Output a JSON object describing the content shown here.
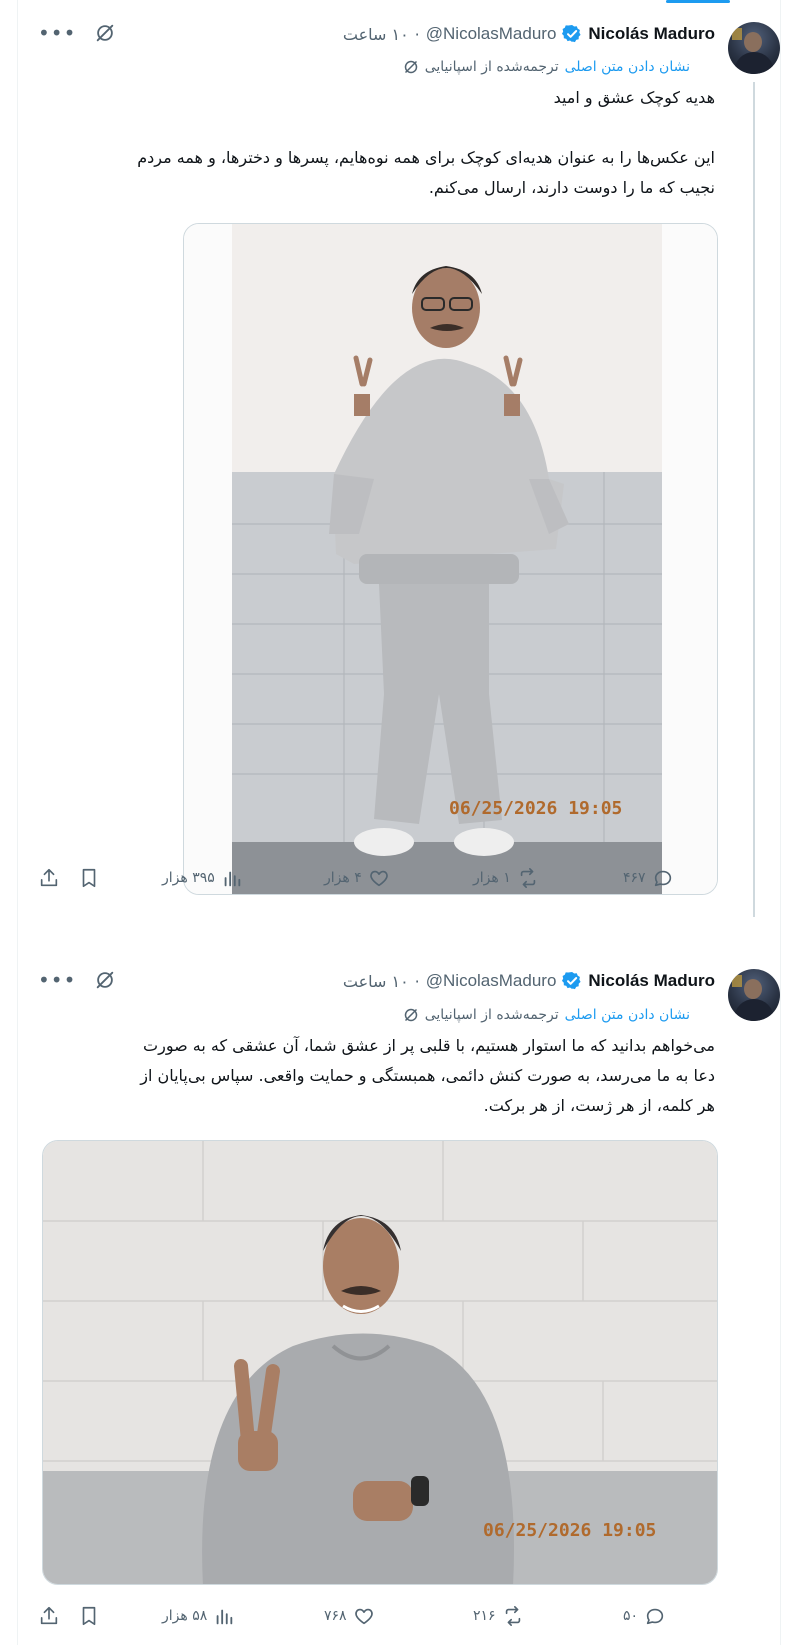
{
  "colors": {
    "accent": "#1d9bf0",
    "text_primary": "#0f1419",
    "text_secondary": "#536471",
    "border": "#cfd9de"
  },
  "tweets": [
    {
      "author": {
        "name": "Nicolás Maduro",
        "handle": "@NicolasMaduro",
        "time": "۱۰ ساعت",
        "separator": "·",
        "verified_icon": "verified-badge-icon"
      },
      "translation": {
        "label": "ترجمه‌شده از اسپانیایی",
        "link": "نشان دادن متن اصلی"
      },
      "text_lines": [
        "هدیه کوچک عشق و امید",
        "",
        "این عکس‌ها را به عنوان هدیه‌ای کوچک برای همه نوه‌هایم، پسرها و دخترها، و همه مردم",
        "نجیب که ما را دوست دارند، ارسال می‌کنم."
      ],
      "media": {
        "description_icon": "photo-man-full-body-peace-sign",
        "timestamp_overlay": "06/25/2026 19:05"
      },
      "stats": {
        "replies": "۴۶۷",
        "reposts": "۱ هزار",
        "likes": "۴ هزار",
        "views": "۳۹۵ هزار"
      }
    },
    {
      "author": {
        "name": "Nicolás Maduro",
        "handle": "@NicolasMaduro",
        "time": "۱۰ ساعت",
        "separator": "·",
        "verified_icon": "verified-badge-icon"
      },
      "translation": {
        "label": "ترجمه‌شده از اسپانیایی",
        "link": "نشان دادن متن اصلی"
      },
      "text_lines": [
        "می‌خواهم بدانید که ما استوار هستیم، با قلبی پر از عشق شما، آن عشقی که به صورت",
        "دعا به ما می‌رسد، به صورت کنش دائمی، همبستگی و حمایت واقعی. سپاس بی‌پایان از",
        "هر کلمه، از هر ژست، از هر برکت."
      ],
      "media": {
        "description_icon": "photo-man-half-body-peace-sign",
        "timestamp_overlay": "06/25/2026 19:05"
      },
      "stats": {
        "replies": "۵۰",
        "reposts": "۲۱۶",
        "likes": "۷۶۸",
        "views": "۵۸ هزار"
      }
    }
  ]
}
